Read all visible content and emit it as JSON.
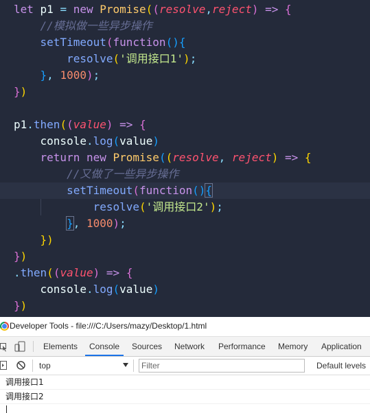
{
  "editor": {
    "lines": [
      [
        [
          "c-kw",
          "let "
        ],
        [
          "c-var",
          "p1 "
        ],
        [
          "c-op",
          "= "
        ],
        [
          "c-kw",
          "new "
        ],
        [
          "c-type",
          "Promise"
        ],
        [
          "c-paren0",
          "("
        ],
        [
          "c-paren1",
          "("
        ],
        [
          "c-param",
          "resolve"
        ],
        [
          "c-punc",
          ","
        ],
        [
          "c-param",
          "reject"
        ],
        [
          "c-paren1",
          ")"
        ],
        [
          "c-plain",
          " "
        ],
        [
          "c-kw",
          "=> "
        ],
        [
          "c-paren1",
          "{"
        ]
      ],
      [
        [
          "c-plain",
          "    "
        ],
        [
          "c-com",
          "//模拟做一些异步操作"
        ]
      ],
      [
        [
          "c-plain",
          "    "
        ],
        [
          "c-fn",
          "setTimeout"
        ],
        [
          "c-paren1",
          "("
        ],
        [
          "c-kw",
          "function"
        ],
        [
          "c-paren2",
          "()"
        ],
        [
          "c-paren2",
          "{"
        ]
      ],
      [
        [
          "c-plain",
          "        "
        ],
        [
          "c-fn",
          "resolve"
        ],
        [
          "c-paren0",
          "("
        ],
        [
          "c-str",
          "'调用接口1'"
        ],
        [
          "c-paren0",
          ")"
        ],
        [
          "c-punc",
          ";"
        ]
      ],
      [
        [
          "c-plain",
          "    "
        ],
        [
          "c-paren2",
          "}"
        ],
        [
          "c-punc",
          ", "
        ],
        [
          "c-num",
          "1000"
        ],
        [
          "c-paren1",
          ")"
        ],
        [
          "c-punc",
          ";"
        ]
      ],
      [
        [
          "c-paren1",
          "}"
        ],
        [
          "c-paren0",
          ")"
        ]
      ],
      [],
      [
        [
          "c-var",
          "p1"
        ],
        [
          "c-punc",
          "."
        ],
        [
          "c-fn",
          "then"
        ],
        [
          "c-paren0",
          "("
        ],
        [
          "c-paren1",
          "("
        ],
        [
          "c-param",
          "value"
        ],
        [
          "c-paren1",
          ")"
        ],
        [
          "c-plain",
          " "
        ],
        [
          "c-kw",
          "=> "
        ],
        [
          "c-paren1",
          "{"
        ]
      ],
      [
        [
          "c-plain",
          "    "
        ],
        [
          "c-var",
          "console"
        ],
        [
          "c-punc",
          "."
        ],
        [
          "c-fn",
          "log"
        ],
        [
          "c-paren2",
          "("
        ],
        [
          "c-var",
          "value"
        ],
        [
          "c-paren2",
          ")"
        ]
      ],
      [
        [
          "c-plain",
          "    "
        ],
        [
          "c-kw",
          "return "
        ],
        [
          "c-kw",
          "new "
        ],
        [
          "c-type",
          "Promise"
        ],
        [
          "c-paren2",
          "("
        ],
        [
          "c-paren0",
          "("
        ],
        [
          "c-param",
          "resolve"
        ],
        [
          "c-punc",
          ", "
        ],
        [
          "c-param",
          "reject"
        ],
        [
          "c-paren0",
          ")"
        ],
        [
          "c-plain",
          " "
        ],
        [
          "c-kw",
          "=> "
        ],
        [
          "c-paren0",
          "{"
        ]
      ],
      [
        [
          "c-plain",
          "        "
        ],
        [
          "c-com",
          "//又做了一些异步操作"
        ]
      ],
      [
        [
          "c-plain",
          "        "
        ],
        [
          "c-fn",
          "setTimeout"
        ],
        [
          "c-paren1",
          "("
        ],
        [
          "c-kw",
          "function"
        ],
        [
          "c-paren2",
          "()"
        ],
        [
          "c-paren2 bm",
          "{"
        ]
      ],
      [
        [
          "c-plain",
          "            "
        ],
        [
          "c-fn",
          "resolve"
        ],
        [
          "c-paren0",
          "("
        ],
        [
          "c-str",
          "'调用接口2'"
        ],
        [
          "c-paren0",
          ")"
        ],
        [
          "c-punc",
          ";"
        ]
      ],
      [
        [
          "c-plain",
          "        "
        ],
        [
          "c-paren2 bm",
          "}"
        ],
        [
          "c-punc",
          ", "
        ],
        [
          "c-num",
          "1000"
        ],
        [
          "c-paren1",
          ")"
        ],
        [
          "c-punc",
          ";"
        ]
      ],
      [
        [
          "c-plain",
          "    "
        ],
        [
          "c-paren0",
          "})"
        ]
      ],
      [
        [
          "c-paren1",
          "}"
        ],
        [
          "c-paren0",
          ")"
        ]
      ],
      [
        [
          "c-punc",
          "."
        ],
        [
          "c-fn",
          "then"
        ],
        [
          "c-paren0",
          "("
        ],
        [
          "c-paren1",
          "("
        ],
        [
          "c-param",
          "value"
        ],
        [
          "c-paren1",
          ")"
        ],
        [
          "c-plain",
          " "
        ],
        [
          "c-kw",
          "=> "
        ],
        [
          "c-paren1",
          "{"
        ]
      ],
      [
        [
          "c-plain",
          "    "
        ],
        [
          "c-var",
          "console"
        ],
        [
          "c-punc",
          "."
        ],
        [
          "c-fn",
          "log"
        ],
        [
          "c-paren2",
          "("
        ],
        [
          "c-var",
          "value"
        ],
        [
          "c-paren2",
          ")"
        ]
      ],
      [
        [
          "c-paren1",
          "}"
        ],
        [
          "c-paren0",
          ")"
        ]
      ]
    ],
    "highlight_line": 11
  },
  "devtools": {
    "window_title": "Developer Tools - file:///C:/Users/mazy/Desktop/1.html",
    "tabs": [
      "Elements",
      "Console",
      "Sources",
      "Network",
      "Performance",
      "Memory",
      "Application"
    ],
    "active_tab": "Console",
    "context": "top",
    "filter_placeholder": "Filter",
    "levels": "Default levels",
    "messages": [
      "调用接口1",
      "调用接口2"
    ]
  }
}
